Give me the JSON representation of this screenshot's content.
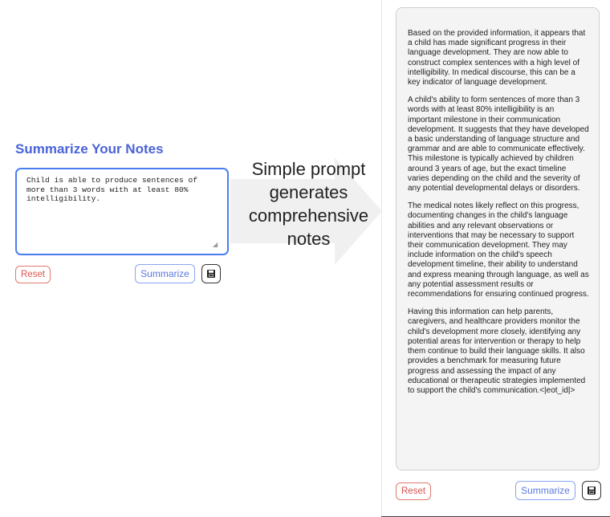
{
  "left_panel": {
    "title": "Summarize Your Notes",
    "input_value": "Child is able to produce sentences of more than 3 words with at least 80% intelligibility.",
    "reset_label": "Reset",
    "summarize_label": "Summarize",
    "save_icon": "floppy-disk-icon"
  },
  "arrow": {
    "line1": "Simple prompt",
    "line2": "generates",
    "line3": "comprehensive",
    "line4": "notes"
  },
  "right_panel": {
    "paragraphs": [
      "Based on the provided information, it appears that a child has made significant progress in their language development. They are now able to construct complex sentences with a high level of intelligibility. In medical discourse, this can be a key indicator of language development.",
      "A child's ability to form sentences of more than 3 words with at least 80% intelligibility is an important milestone in their communication development. It suggests that they have developed a basic understanding of language structure and grammar and are able to communicate effectively. This milestone is typically achieved by children around 3 years of age, but the exact timeline varies depending on the child and the severity of any potential developmental delays or disorders.",
      "The medical notes likely reflect on this progress, documenting changes in the child's language abilities and any relevant observations or interventions that may be necessary to support their communication development. They may include information on the child's speech development timeline, their ability to understand and express meaning through language, as well as any potential assessment results or recommendations for ensuring continued progress.",
      "Having this information can help parents, caregivers, and healthcare providers monitor the child's development more closely, identifying any potential areas for intervention or therapy to help them continue to build their language skills. It also provides a benchmark for measuring future progress and assessing the impact of any educational or therapeutic strategies implemented to support the child's communication.<|eot_id|>"
    ],
    "reset_label": "Reset",
    "summarize_label": "Summarize",
    "save_icon": "floppy-disk-icon"
  },
  "colors": {
    "accent": "#4a63d8",
    "reset": "#d9534f",
    "arrow": "#f0f0f0"
  }
}
